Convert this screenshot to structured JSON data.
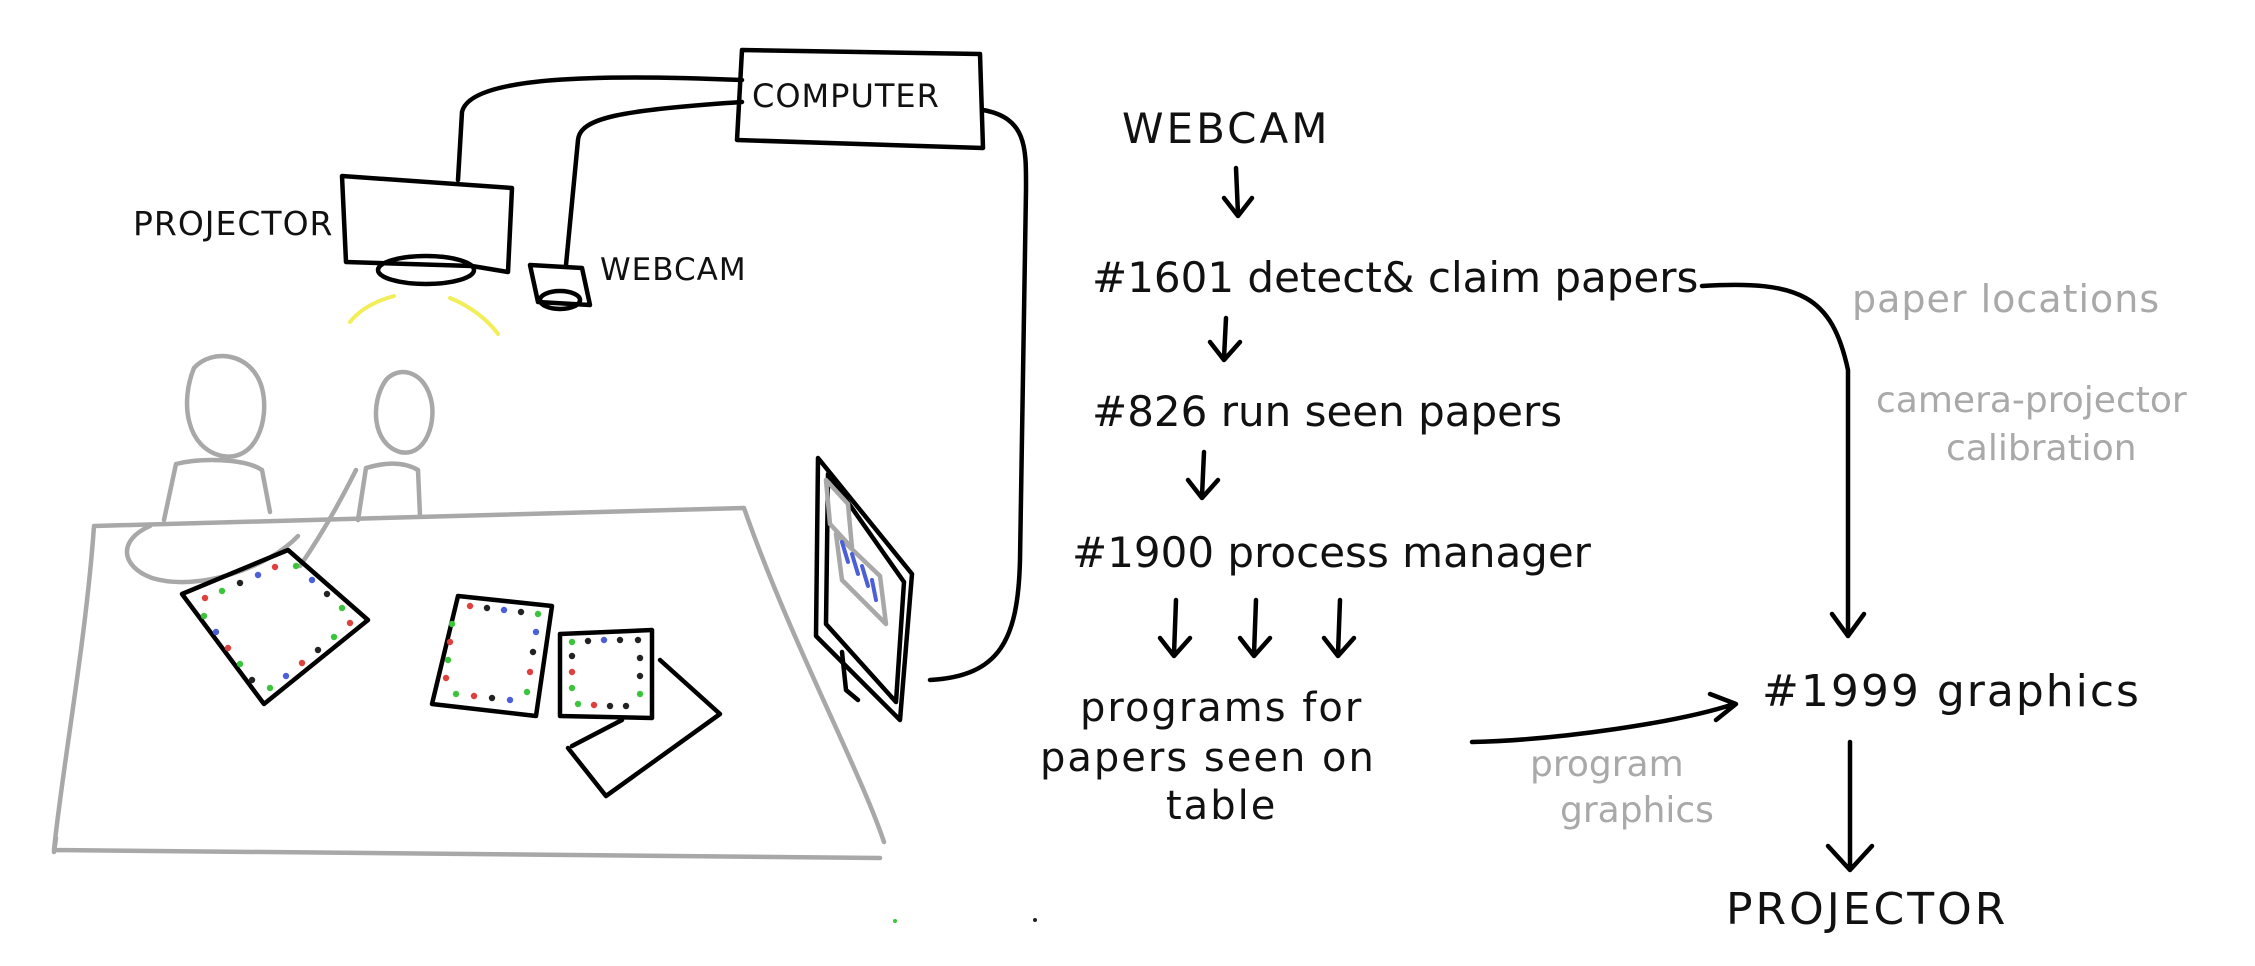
{
  "hardware": {
    "computer_label": "COMPUTER",
    "projector_label": "PROJECTOR",
    "webcam_label": "WEBCAM"
  },
  "flow": {
    "webcam": "WEBCAM",
    "detect": "#1601 detect& claim papers",
    "run": "#826 run seen papers",
    "process": "#1900 process manager",
    "programs_line1": "programs for",
    "programs_line2": "papers seen on",
    "programs_line3": "table",
    "graphics": "#1999 graphics",
    "projector": "PROJECTOR"
  },
  "annotations": {
    "paper_locations": "paper locations",
    "calibration_line1": "camera-projector",
    "calibration_line2": "calibration",
    "program_graphics_line1": "program",
    "program_graphics_line2": "graphics"
  },
  "colors": {
    "ink": "#000000",
    "table_gray": "#a8a8a8",
    "annotation_gray": "#a9a9a9",
    "projector_light": "#f2ee5a",
    "dot_red": "#e0403c",
    "dot_green": "#3cc43c",
    "dot_blue": "#4a5fd8",
    "dot_black": "#222222"
  }
}
